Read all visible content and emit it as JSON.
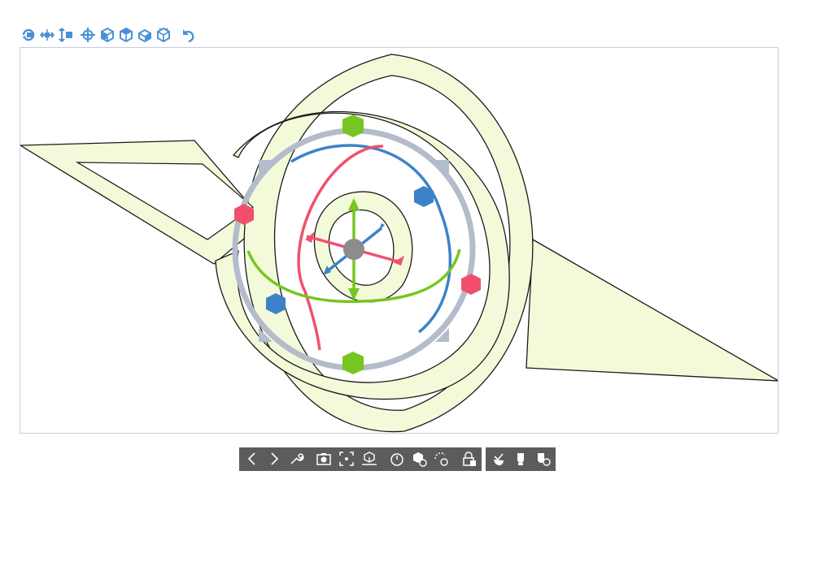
{
  "top_toolbar": {
    "icon_color": "#4a90d6",
    "icons": [
      "rotate-view-icon",
      "pan-horizontal-icon",
      "pan-vertical-icon",
      "center-target-icon",
      "front-view-icon",
      "top-view-icon",
      "side-view-icon",
      "perspective-view-icon",
      "undo-icon"
    ]
  },
  "scene": {
    "model_fill": "#f3fad9",
    "model_stroke": "#1a1a1a",
    "gizmo": {
      "x_axis_color": "#f0506e",
      "y_axis_color": "#77c520",
      "z_axis_color": "#3c82c8",
      "ring_color": "#b4bccc",
      "center_color": "#8c8c8c"
    }
  },
  "bottom_toolbar": {
    "background": "#5c5c5c",
    "icon_color": "#ffffff",
    "left_icons": [
      "previous-icon",
      "next-icon",
      "wrench-icon",
      "camera-icon",
      "fit-screen-icon",
      "place-on-ground-icon",
      "timer-icon",
      "model-settings-icon",
      "rotate-settings-icon",
      "lock-icon"
    ],
    "right_icons": [
      "hand-pose-icon",
      "hand-light-icon",
      "hand-settings-icon"
    ]
  }
}
